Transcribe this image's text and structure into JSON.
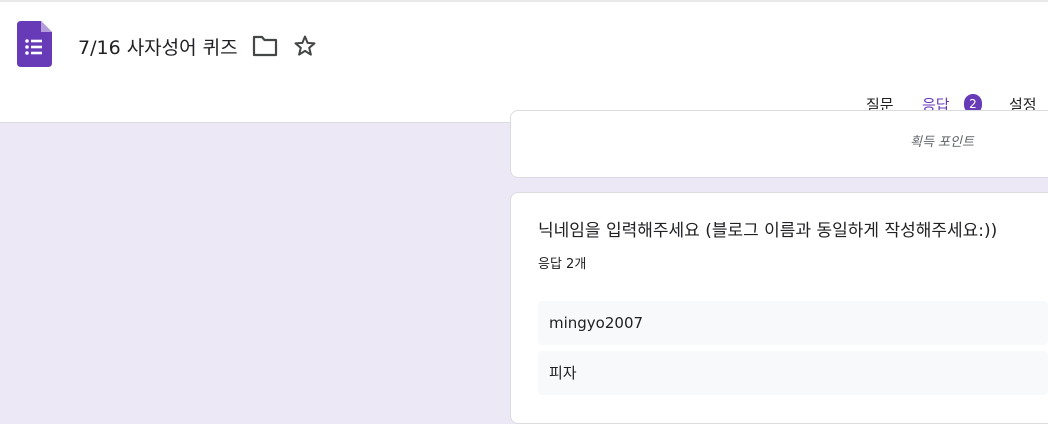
{
  "header": {
    "title": "7/16 사자성어 퀴즈",
    "icons": [
      "forms-document-icon",
      "folder-icon",
      "star-icon"
    ]
  },
  "tabs": [
    {
      "label": "질문",
      "active": false
    },
    {
      "label": "응답",
      "active": true,
      "badge": "2"
    },
    {
      "label": "설정",
      "active": false
    }
  ],
  "points_label": "획득 포인트",
  "question": {
    "title": "닉네임을 입력해주세요 (블로그 이름과 동일하게 작성해주세요:))",
    "response_count": "응답 2개",
    "answers": [
      "mingyo2007",
      "피자"
    ]
  },
  "colors": {
    "accent": "#673ab7",
    "page_background": "#ede8f6",
    "answer_background": "#f8f9fa"
  }
}
